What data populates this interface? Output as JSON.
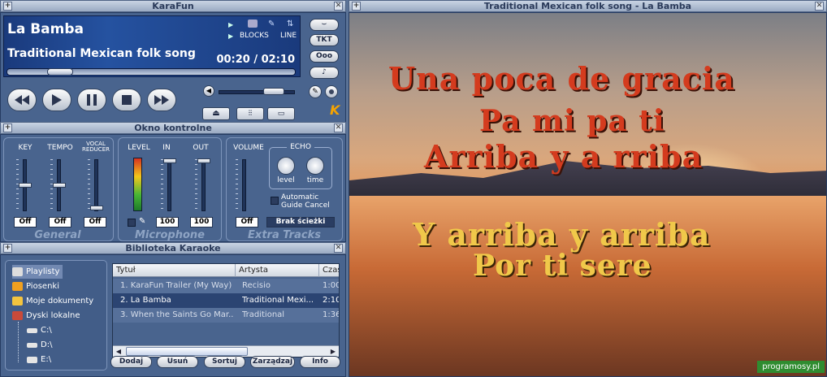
{
  "player": {
    "title": "KaraFun",
    "song_title": "La Bamba",
    "artist": "Traditional Mexican folk song",
    "blocks_label": "BLOCKS",
    "line_label": "LINE",
    "time": "00:20 / 02:10",
    "progress": 0.15,
    "volume": 0.8,
    "k_logo": "K"
  },
  "side_buttons": [
    "TKT",
    "Ooo"
  ],
  "control": {
    "title": "Okno kontrolne",
    "key": "KEY",
    "tempo": "TEMPO",
    "vocal_reducer": "VOCAL REDUCER",
    "level": "LEVEL",
    "in": "IN",
    "out": "OUT",
    "volume": "VOLUME",
    "echo": "ECHO",
    "echo_level": "level",
    "echo_time": "time",
    "auto_cancel": "Automatic Guide Cancel",
    "key_val": "Off",
    "tempo_val": "Off",
    "vocal_val": "Off",
    "in_val": "100",
    "out_val": "100",
    "vol_val": "Off",
    "brak": "Brak ścieżki",
    "general": "General",
    "microphone": "Microphone",
    "extra": "Extra Tracks"
  },
  "library": {
    "title": "Biblioteka Karaoke",
    "tree": [
      "Playlisty",
      "Piosenki",
      "Moje dokumenty",
      "Dyski lokalne",
      "C:\\",
      "D:\\",
      "E:\\"
    ],
    "columns": [
      "Tytuł",
      "Artysta",
      "Czas"
    ],
    "rows": [
      {
        "title": "1. KaraFun Trailer (My Way)",
        "artist": "Recisio",
        "time": "1:00"
      },
      {
        "title": "2. La Bamba",
        "artist": "Traditional Mexi...",
        "time": "2:10"
      },
      {
        "title": "3. When the Saints Go Mar...",
        "artist": "Traditional",
        "time": "1:36"
      }
    ],
    "buttons": [
      "Dodaj",
      "Usuń",
      "Sortuj",
      "Zarządzaj",
      "Info"
    ]
  },
  "karaoke": {
    "title": "Traditional Mexican folk song - La Bamba",
    "lines": [
      "Una poca de gracia",
      "Pa mi pa ti",
      "Arriba y a rriba",
      "Y arriba y arriba",
      "Por ti sere"
    ],
    "watermark": "programosy.pl"
  },
  "colors": {
    "lyric_sung": "#d43b1e",
    "lyric_next": "#f0c84a"
  }
}
